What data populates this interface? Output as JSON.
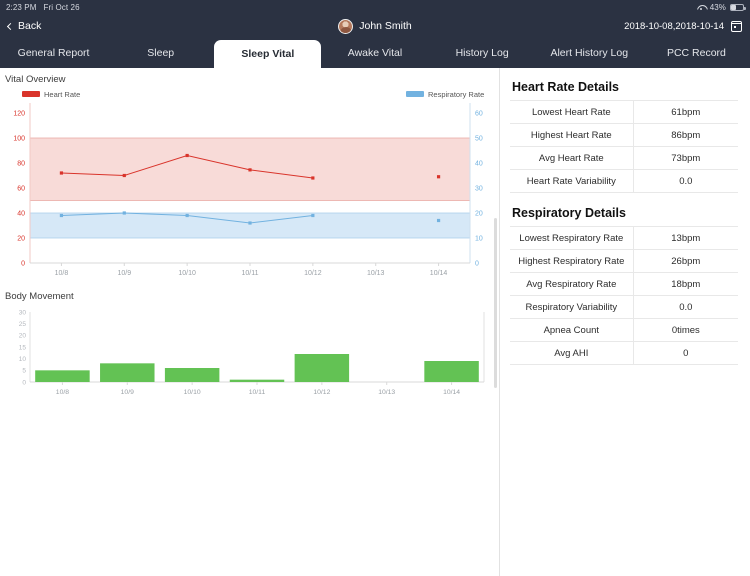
{
  "status_bar": {
    "time": "2:23 PM",
    "date": "Fri Oct 26",
    "wifi_icon": "wifi-icon",
    "battery_percent": "43%",
    "battery_level": 43
  },
  "nav": {
    "back_label": "Back",
    "back_icon": "chevron-left-icon",
    "user_name": "John Smith",
    "avatar_icon": "avatar",
    "date_range": "2018-10-08,2018-10-14",
    "calendar_icon": "calendar-icon"
  },
  "tabs": [
    {
      "label": "General Report",
      "active": false
    },
    {
      "label": "Sleep",
      "active": false
    },
    {
      "label": "Sleep Vital",
      "active": true
    },
    {
      "label": "Awake Vital",
      "active": false
    },
    {
      "label": "History Log",
      "active": false
    },
    {
      "label": "Alert History Log",
      "active": false
    },
    {
      "label": "PCC Record",
      "active": false
    }
  ],
  "left": {
    "vital_title": "Vital Overview",
    "movement_title": "Body Movement"
  },
  "colors": {
    "heart_rate": "#d9342b",
    "heart_rate_band": "#f7d5d1",
    "respiratory_rate": "#72b2e0",
    "respiratory_band": "#cfe4f6",
    "movement_bar": "#63c254",
    "navbar": "#2b3242"
  },
  "chart_data": [
    {
      "type": "line",
      "title": "Vital Overview",
      "categories": [
        "10/8",
        "10/9",
        "10/10",
        "10/11",
        "10/12",
        "10/13",
        "10/14"
      ],
      "xlabel": "",
      "grid": false,
      "legend": [
        "Heart Rate",
        "Respiratory Rate"
      ],
      "legend_position": "top",
      "axes": {
        "left": {
          "label": "Heart Rate",
          "ticks": [
            0,
            20,
            40,
            60,
            80,
            100,
            120
          ],
          "ylim": [
            0,
            120
          ],
          "color": "#d9342b"
        },
        "right": {
          "label": "Respiratory Rate",
          "ticks": [
            0,
            10,
            20,
            30,
            40,
            50,
            60
          ],
          "ylim": [
            0,
            60
          ],
          "color": "#72b2e0"
        }
      },
      "bands": [
        {
          "name": "Heart Rate normal band",
          "axis": "left",
          "from": 50,
          "to": 100,
          "color": "#f7d5d1"
        },
        {
          "name": "Respiratory normal band",
          "axis": "left",
          "from": 20,
          "to": 40,
          "color": "#cfe4f6"
        }
      ],
      "series": [
        {
          "name": "Heart Rate",
          "axis": "left",
          "color": "#d9342b",
          "values": [
            72,
            70,
            86,
            74.5,
            68,
            null,
            69
          ]
        },
        {
          "name": "Respiratory Rate",
          "axis": "right",
          "color": "#72b2e0",
          "values": [
            19,
            20,
            19,
            16,
            19,
            null,
            17
          ]
        }
      ]
    },
    {
      "type": "bar",
      "title": "Body Movement",
      "categories": [
        "10/8",
        "10/9",
        "10/10",
        "10/11",
        "10/12",
        "10/13",
        "10/14"
      ],
      "values": [
        5,
        8,
        6,
        1,
        12,
        0,
        9
      ],
      "ylabel": "",
      "xlabel": "",
      "ylim": [
        0,
        30
      ],
      "yticks": [
        0,
        5,
        10,
        15,
        20,
        25,
        30
      ],
      "grid": false,
      "color": "#63c254"
    }
  ],
  "heart_rate_details": {
    "title": "Heart Rate Details",
    "rows": [
      {
        "key": "Lowest Heart Rate",
        "value": "61bpm"
      },
      {
        "key": "Highest Heart Rate",
        "value": "86bpm"
      },
      {
        "key": "Avg Heart Rate",
        "value": "73bpm"
      },
      {
        "key": "Heart Rate Variability",
        "value": "0.0"
      }
    ]
  },
  "respiratory_details": {
    "title": "Respiratory Details",
    "rows": [
      {
        "key": "Lowest Respiratory Rate",
        "value": "13bpm"
      },
      {
        "key": "Highest Respiratory Rate",
        "value": "26bpm"
      },
      {
        "key": "Avg Respiratory Rate",
        "value": "18bpm"
      },
      {
        "key": "Respiratory Variability",
        "value": "0.0"
      },
      {
        "key": "Apnea Count",
        "value": "0times"
      },
      {
        "key": "Avg AHI",
        "value": "0"
      }
    ]
  }
}
